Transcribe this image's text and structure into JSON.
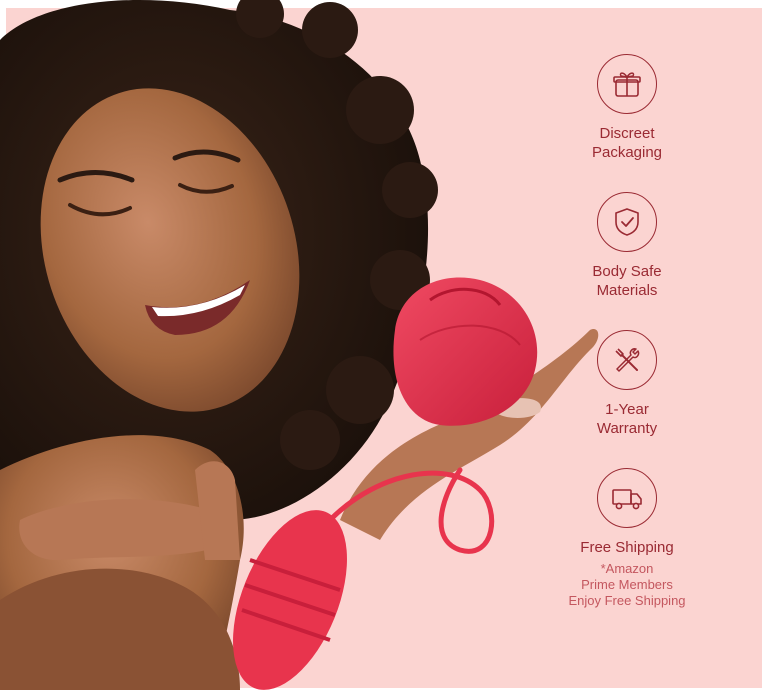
{
  "features": [
    {
      "icon": "gift-icon",
      "label": "Discreet\nPackaging"
    },
    {
      "icon": "shield-check-icon",
      "label": "Body Safe\nMaterials"
    },
    {
      "icon": "tools-icon",
      "label": "1-Year\nWarranty"
    },
    {
      "icon": "truck-icon",
      "label": "Free Shipping",
      "note": "*Amazon\nPrime Members\nEnjoy Free Shipping"
    }
  ],
  "colors": {
    "background": "#fbd4d1",
    "accent": "#9a2a33",
    "note": "#c4575f",
    "product": "#e8344d",
    "skin": "#a86a4c",
    "hair": "#2b1a12"
  }
}
